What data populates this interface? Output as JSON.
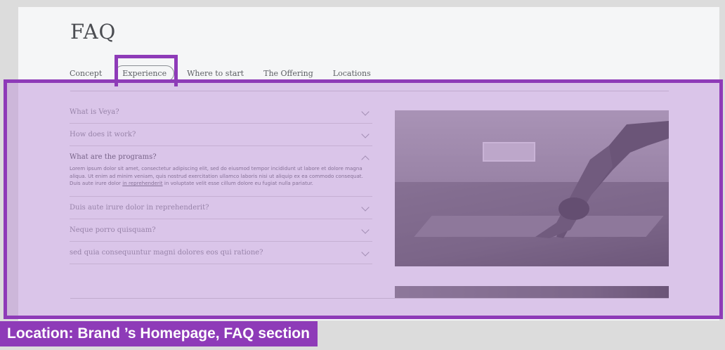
{
  "faq": {
    "title": "FAQ",
    "tabs": [
      {
        "label": "Concept",
        "active": false
      },
      {
        "label": "Experience",
        "active": true
      },
      {
        "label": "Where to start",
        "active": false
      },
      {
        "label": "The Offering",
        "active": false
      },
      {
        "label": "Locations",
        "active": false
      }
    ],
    "questions": [
      {
        "q": "What is Veya?",
        "open": false
      },
      {
        "q": "How does it work?",
        "open": false
      },
      {
        "q": "What are the programs?",
        "open": true,
        "answer_before_link": "Lorem ipsum dolor sit amet, consectetur adipiscing elit, sed do eiusmod tempor incididunt ut labore et dolore magna aliqua. Ut enim ad minim veniam, quis nostrud exercitation ullamco laboris nisi ut aliquip ex ea commodo consequat. Duis aute irure dolor ",
        "answer_link": "in reprehenderit",
        "answer_after_link": " in voluptate velit esse cillum dolore eu fugiat nulla pariatur."
      },
      {
        "q": "Duis aute irure dolor in reprehenderit?",
        "open": false
      },
      {
        "q": "Neque porro quisquam?",
        "open": false
      },
      {
        "q": "sed quia consequuntur magni dolores eos qui ratione?",
        "open": false
      }
    ]
  },
  "annotation": {
    "label": "Location: Brand ’s Homepage, FAQ section",
    "color": "#8e3bb8"
  }
}
